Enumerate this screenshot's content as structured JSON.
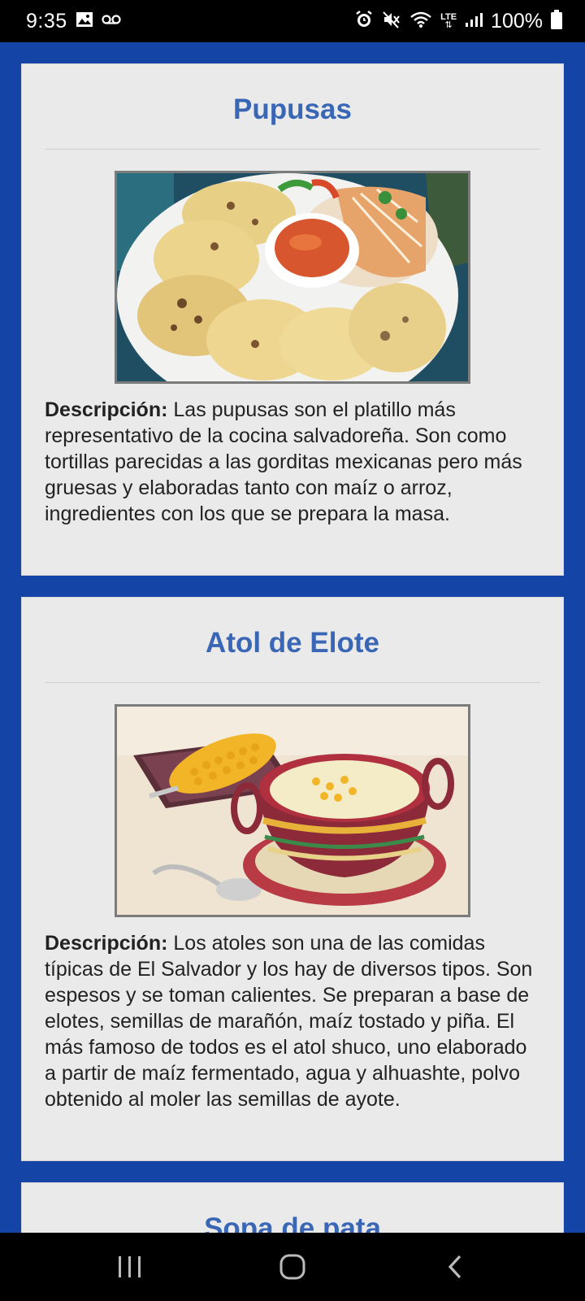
{
  "status_bar": {
    "time": "9:35",
    "network": "LTE",
    "battery": "100%",
    "icons": [
      "gallery-icon",
      "voicemail-icon",
      "alarm-icon",
      "mute-icon",
      "wifi-icon",
      "lte-icon",
      "signal-icon",
      "battery-icon"
    ]
  },
  "cards": [
    {
      "title": "Pupusas",
      "image_alt": "pupusas-photo",
      "desc_label": "Descripción:",
      "desc_text": "Las pupusas son el platillo más representativo de la cocina salvadoreña. Son como tortillas parecidas a las gorditas mexicanas pero más gruesas y elaboradas tanto con maíz o arroz, ingredientes con los que se prepara la masa."
    },
    {
      "title": "Atol de Elote",
      "image_alt": "atol-de-elote-photo",
      "desc_label": "Descripción:",
      "desc_text": "Los atoles son una de las comidas típicas de El Salvador y los hay de diversos tipos. Son espesos y se toman calientes. Se preparan a base de elotes, semillas de marañón, maíz tostado y piña. El más famoso de todos es el atol shuco, uno elaborado a partir de maíz fermentado, agua y alhuashte, polvo obtenido al moler las semillas de ayote."
    },
    {
      "title": "Sopa de pata"
    }
  ],
  "colors": {
    "background": "#1445a6",
    "card": "#eaeaea",
    "title": "#3a67b5"
  },
  "nav": {
    "icons": [
      "recents-icon",
      "home-icon",
      "back-icon"
    ]
  }
}
